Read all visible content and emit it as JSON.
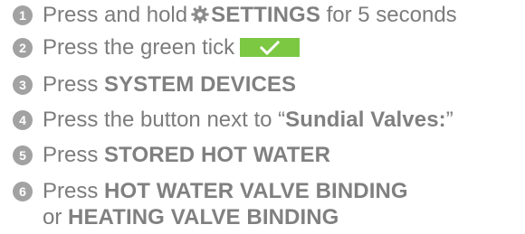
{
  "steps": [
    {
      "number": "1",
      "text_before": "Press and hold",
      "icon": "gear-icon",
      "keyword": "SETTINGS",
      "text_after": "for 5 seconds"
    },
    {
      "number": "2",
      "text": "Press the green tick",
      "icon": "check-icon",
      "tick_color": "#7cc843"
    },
    {
      "number": "3",
      "text": "Press",
      "keyword": "SYSTEM DEVICES"
    },
    {
      "number": "4",
      "text": "Press the button next to “",
      "keyword": "Sundial Valves:",
      "text_after": "”"
    },
    {
      "number": "5",
      "text": "Press",
      "keyword": "STORED HOT WATER"
    },
    {
      "number": "6",
      "text": "Press",
      "keyword": "HOT WATER VALVE BINDING",
      "line2_text": "or",
      "line2_keyword": "HEATING VALVE BINDING"
    }
  ],
  "colors": {
    "text": "#7c7c7c",
    "number_circle": "#a2a2a2",
    "tick_box": "#7cc843"
  }
}
